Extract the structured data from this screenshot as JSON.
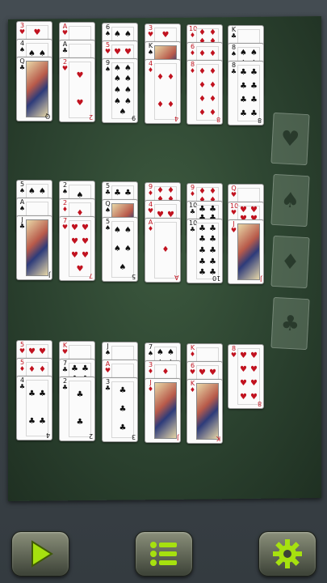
{
  "colors": {
    "felt": "#2c4330",
    "red_suit": "#c1121f",
    "black_suit": "#111111",
    "button_icon": "#a6e10f"
  },
  "tableau": {
    "row1": [
      {
        "cards": [
          {
            "rank": "3",
            "suit": "♥",
            "color": "red"
          },
          {
            "rank": "4",
            "suit": "♠",
            "color": "black"
          },
          {
            "rank": "Q",
            "suit": "♣",
            "color": "black",
            "face": true
          }
        ]
      },
      {
        "cards": [
          {
            "rank": "A",
            "suit": "♥",
            "color": "red"
          },
          {
            "rank": "A",
            "suit": "♣",
            "color": "black"
          },
          {
            "rank": "2",
            "suit": "♥",
            "color": "red"
          }
        ]
      },
      {
        "cards": [
          {
            "rank": "6",
            "suit": "♠",
            "color": "black"
          },
          {
            "rank": "5",
            "suit": "♥",
            "color": "red"
          },
          {
            "rank": "9",
            "suit": "♠",
            "color": "black"
          }
        ]
      },
      {
        "cards": [
          {
            "rank": "3",
            "suit": "♥",
            "color": "red"
          },
          {
            "rank": "K",
            "suit": "♠",
            "color": "black",
            "face": true
          },
          {
            "rank": "4",
            "suit": "♦",
            "color": "red"
          }
        ]
      },
      {
        "cards": [
          {
            "rank": "10",
            "suit": "♦",
            "color": "red"
          },
          {
            "rank": "6",
            "suit": "♦",
            "color": "red"
          },
          {
            "rank": "8",
            "suit": "♦",
            "color": "red"
          }
        ]
      },
      {
        "cards": [
          {
            "rank": "K",
            "suit": "♣",
            "color": "black"
          },
          {
            "rank": "8",
            "suit": "♠",
            "color": "black"
          },
          {
            "rank": "8",
            "suit": "♣",
            "color": "black"
          }
        ]
      }
    ],
    "row2": [
      {
        "cards": [
          {
            "rank": "5",
            "suit": "♠",
            "color": "black"
          },
          {
            "rank": "A",
            "suit": "♠",
            "color": "black"
          },
          {
            "rank": "J",
            "suit": "♣",
            "color": "black",
            "face": true
          }
        ]
      },
      {
        "cards": [
          {
            "rank": "2",
            "suit": "♠",
            "color": "black"
          },
          {
            "rank": "2",
            "suit": "♦",
            "color": "red"
          },
          {
            "rank": "7",
            "suit": "♥",
            "color": "red"
          }
        ]
      },
      {
        "cards": [
          {
            "rank": "5",
            "suit": "♣",
            "color": "black"
          },
          {
            "rank": "Q",
            "suit": "♠",
            "color": "black",
            "face": true
          },
          {
            "rank": "5",
            "suit": "♠",
            "color": "black"
          }
        ]
      },
      {
        "cards": [
          {
            "rank": "9",
            "suit": "♦",
            "color": "red"
          },
          {
            "rank": "4",
            "suit": "♥",
            "color": "red"
          },
          {
            "rank": "A",
            "suit": "♦",
            "color": "red"
          }
        ]
      },
      {
        "cards": [
          {
            "rank": "9",
            "suit": "♦",
            "color": "red"
          },
          {
            "rank": "10",
            "suit": "♣",
            "color": "black"
          },
          {
            "rank": "10",
            "suit": "♣",
            "color": "black"
          }
        ]
      },
      {
        "cards": [
          {
            "rank": "Q",
            "suit": "♥",
            "color": "red"
          },
          {
            "rank": "10",
            "suit": "♥",
            "color": "red"
          },
          {
            "rank": "J",
            "suit": "♥",
            "color": "red",
            "face": true
          }
        ]
      }
    ],
    "row3": [
      {
        "cards": [
          {
            "rank": "5",
            "suit": "♥",
            "color": "red"
          },
          {
            "rank": "5",
            "suit": "♦",
            "color": "red"
          },
          {
            "rank": "4",
            "suit": "♣",
            "color": "black"
          }
        ]
      },
      {
        "cards": [
          {
            "rank": "K",
            "suit": "♥",
            "color": "red"
          },
          {
            "rank": "7",
            "suit": "♣",
            "color": "black"
          },
          {
            "rank": "2",
            "suit": "♣",
            "color": "black"
          }
        ]
      },
      {
        "cards": [
          {
            "rank": "J",
            "suit": "♠",
            "color": "black"
          },
          {
            "rank": "A",
            "suit": "♥",
            "color": "red"
          },
          {
            "rank": "3",
            "suit": "♣",
            "color": "black"
          }
        ]
      },
      {
        "cards": [
          {
            "rank": "7",
            "suit": "♠",
            "color": "black"
          },
          {
            "rank": "3",
            "suit": "♦",
            "color": "red"
          },
          {
            "rank": "J",
            "suit": "♦",
            "color": "red",
            "face": true
          }
        ]
      },
      {
        "cards": [
          {
            "rank": "K",
            "suit": "♦",
            "color": "red"
          },
          {
            "rank": "6",
            "suit": "♥",
            "color": "red"
          },
          {
            "rank": "K",
            "suit": "♦",
            "color": "red",
            "face": true
          }
        ]
      },
      {
        "cards": [
          {
            "rank": "8",
            "suit": "♥",
            "color": "red"
          }
        ]
      }
    ]
  },
  "foundations": [
    {
      "suit": "♥"
    },
    {
      "suit": "♠"
    },
    {
      "suit": "♦"
    },
    {
      "suit": "♣"
    }
  ],
  "toolbar": {
    "play_icon": "play-icon",
    "menu_icon": "menu-list-icon",
    "settings_icon": "gear-icon"
  }
}
